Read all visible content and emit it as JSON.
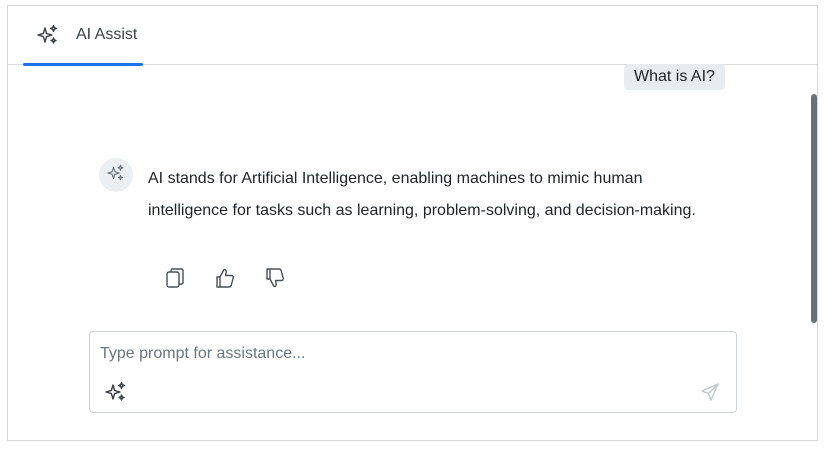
{
  "header": {
    "tab_label": "AI Assist",
    "tab_icon": "sparkle-icon",
    "indicator_color": "#1a73e8"
  },
  "conversation": {
    "user_prompt": "What is AI?",
    "assistant_response": "AI stands for Artificial Intelligence, enabling machines to mimic human intelligence for tasks such as learning, problem-solving, and decision-making.",
    "response_actions": [
      {
        "name": "copy",
        "icon": "copy-icon"
      },
      {
        "name": "like",
        "icon": "thumbs-up-icon"
      },
      {
        "name": "dislike",
        "icon": "thumbs-down-icon"
      }
    ]
  },
  "prompt": {
    "placeholder": "Type prompt for assistance...",
    "value": ""
  },
  "colors": {
    "user_bubble_bg": "#e9ecef",
    "avatar_bg": "#eceff2",
    "scrollbar": "#6b7075"
  }
}
